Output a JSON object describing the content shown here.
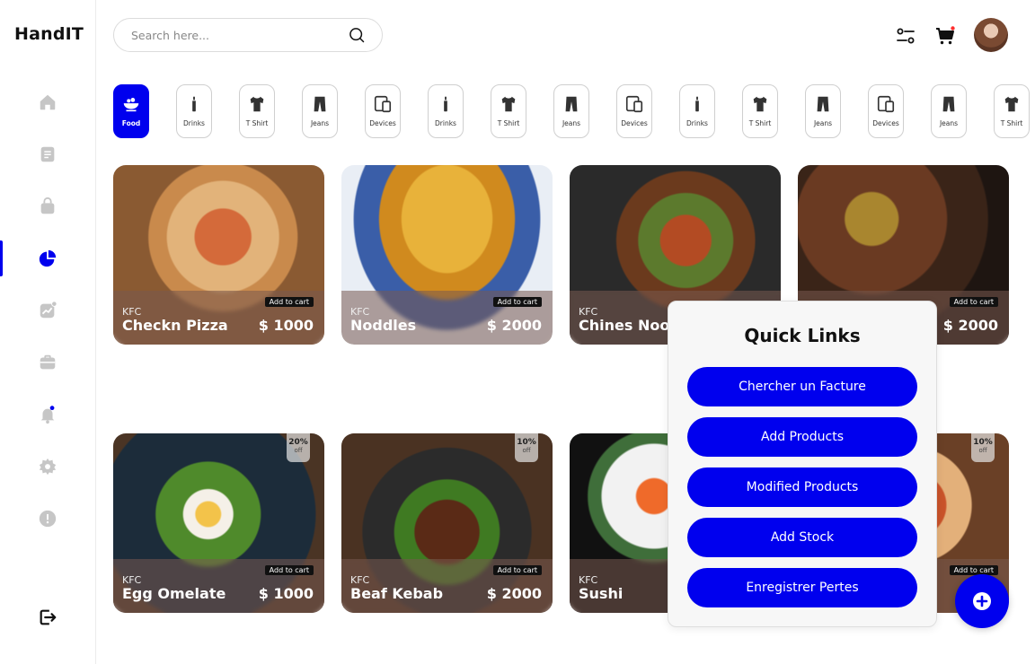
{
  "app": {
    "logo": "HandIT"
  },
  "header": {
    "search_placeholder": "Search here...",
    "icons": [
      "search-icon",
      "filter-icon",
      "cart-icon"
    ],
    "cart_badge_color": "#ff2d2d"
  },
  "sidebar": {
    "items": [
      {
        "icon": "home-icon"
      },
      {
        "icon": "document-icon"
      },
      {
        "icon": "bag-icon"
      },
      {
        "icon": "pie-chart-icon",
        "active": true
      },
      {
        "icon": "trending-icon"
      },
      {
        "icon": "briefcase-icon"
      },
      {
        "icon": "bell-icon"
      },
      {
        "icon": "settings-icon"
      },
      {
        "icon": "alert-icon"
      }
    ],
    "logout_icon": "logout-icon"
  },
  "categories": [
    {
      "label": "Food",
      "icon": "food-bowl-icon",
      "active": true
    },
    {
      "label": "Drinks",
      "icon": "bottle-icon"
    },
    {
      "label": "T Shirt",
      "icon": "tshirt-icon"
    },
    {
      "label": "Jeans",
      "icon": "jeans-icon"
    },
    {
      "label": "Devices",
      "icon": "devices-icon"
    },
    {
      "label": "Drinks",
      "icon": "bottle-icon"
    },
    {
      "label": "T Shirt",
      "icon": "tshirt-icon"
    },
    {
      "label": "Jeans",
      "icon": "jeans-icon"
    },
    {
      "label": "Devices",
      "icon": "devices-icon"
    },
    {
      "label": "Drinks",
      "icon": "bottle-icon"
    },
    {
      "label": "T Shirt",
      "icon": "tshirt-icon"
    },
    {
      "label": "Jeans",
      "icon": "jeans-icon"
    },
    {
      "label": "Devices",
      "icon": "devices-icon"
    },
    {
      "label": "Jeans",
      "icon": "jeans-icon"
    },
    {
      "label": "T Shirt",
      "icon": "tshirt-icon"
    }
  ],
  "products": [
    {
      "brand": "KFC",
      "name": "Checkn Pizza",
      "price": "$ 1000",
      "cart_label": "Add to cart",
      "discount": "",
      "off": ""
    },
    {
      "brand": "KFC",
      "name": "Noddles",
      "price": "$ 2000",
      "cart_label": "Add to cart",
      "discount": "",
      "off": ""
    },
    {
      "brand": "KFC",
      "name": "Chines Nood",
      "price": "",
      "cart_label": "",
      "discount": "",
      "off": ""
    },
    {
      "brand": "",
      "name": "",
      "price": "$ 2000",
      "cart_label": "Add to cart",
      "discount": "",
      "off": ""
    },
    {
      "brand": "KFC",
      "name": "Egg Omelate",
      "price": "$ 1000",
      "cart_label": "Add to cart",
      "discount": "20%",
      "off": "off"
    },
    {
      "brand": "KFC",
      "name": "Beaf Kebab",
      "price": "$ 2000",
      "cart_label": "Add to cart",
      "discount": "10%",
      "off": "off"
    },
    {
      "brand": "KFC",
      "name": "Sushi",
      "price": "",
      "cart_label": "",
      "discount": "",
      "off": ""
    },
    {
      "brand": "",
      "name": "",
      "price": "$",
      "cart_label": "Add to cart",
      "discount": "10%",
      "off": "off"
    }
  ],
  "quick_links": {
    "title": "Quick Links",
    "buttons": [
      "Chercher un Facture",
      "Add Products",
      "Modified Products",
      "Add Stock",
      "Enregistrer Pertes"
    ]
  },
  "fab": {
    "icon": "plus-icon"
  },
  "colors": {
    "accent": "#0000ee"
  }
}
